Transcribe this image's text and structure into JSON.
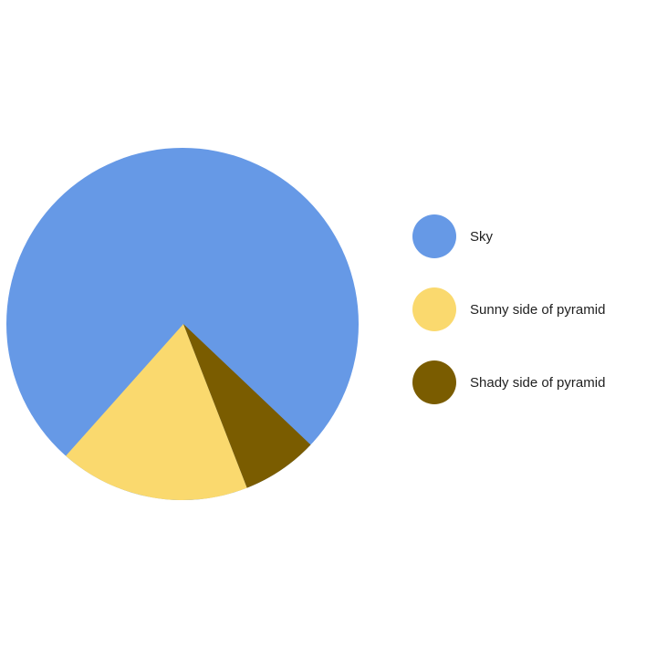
{
  "chart_data": {
    "type": "pie",
    "title": "",
    "slices": [
      {
        "label": "Sky",
        "value": 75.5,
        "color": "#6699E6"
      },
      {
        "label": "Sunny side of pyramid",
        "value": 17.5,
        "color": "#FAD96E"
      },
      {
        "label": "Shady side of pyramid",
        "value": 7.0,
        "color": "#7A5C00"
      }
    ],
    "legend_position": "right",
    "legend_marker": "circle"
  }
}
